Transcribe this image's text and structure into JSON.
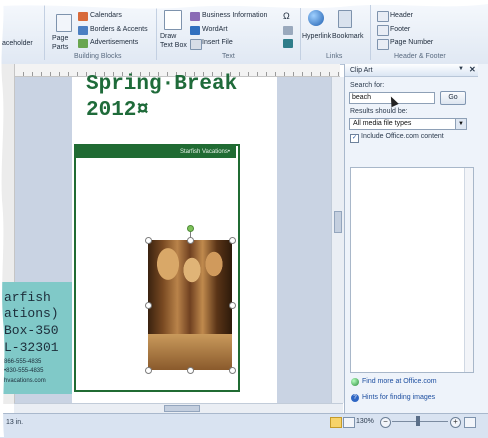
{
  "ribbon": {
    "insert_placeholder": "aceholder",
    "page_parts": "Page\nParts",
    "calendars": "Calendars",
    "borders_accents": "Borders & Accents",
    "advertisements": "Advertisements",
    "building_blocks_group": "Building Blocks",
    "draw_text_box": "Draw\nText Box",
    "business_information": "Business Information",
    "wordart": "WordArt",
    "insert_file": "Insert File",
    "text_group": "Text",
    "hyperlink": "Hyperlink",
    "bookmark": "Bookmark",
    "links_group": "Links",
    "header": "Header",
    "footer": "Footer",
    "page_number": "Page Number",
    "header_footer_group": "Header & Footer",
    "omega": "Ω"
  },
  "document": {
    "heading_line1": "Spring·Break",
    "heading_line2": "2012¤",
    "flyer_banner": "Starfish Vacations•",
    "teal_lines": [
      "arfish",
      "ations)",
      "Box-350",
      "L-32301"
    ],
    "teal_small": [
      "866-555-4835",
      "•830-555-4835",
      "hvacations.com"
    ]
  },
  "clip_art": {
    "title": "Clip Art",
    "search_for_label": "Search for:",
    "search_value": "beach",
    "go_label": "Go",
    "results_label": "Results should be:",
    "media_type": "All media file types",
    "include_office": "Include Office.com content",
    "find_more": "Find more at Office.com",
    "hints": "Hints for finding images"
  },
  "status": {
    "position": "13 in.",
    "zoom": "130%"
  },
  "colors": {
    "accent_green": "#206b33",
    "teal": "#80c9c8",
    "ribbon_bg": "#e0e8f3"
  }
}
